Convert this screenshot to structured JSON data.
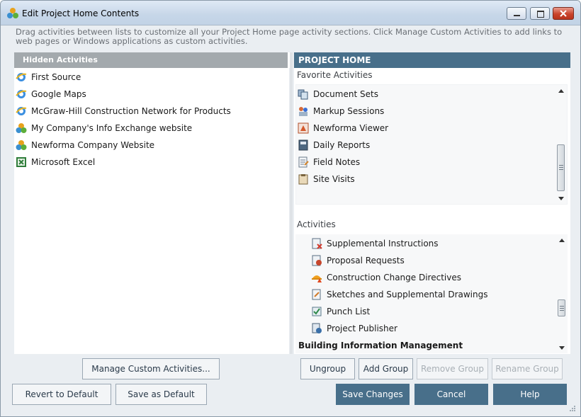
{
  "window": {
    "title": "Edit Project Home Contents"
  },
  "description": "Drag activities between lists to customize all your Project Home page activity sections.  Click Manage Custom Activities to add links to web pages or Windows applications as custom activities.",
  "hidden": {
    "header": "Hidden Activities",
    "items": [
      {
        "label": "First Source",
        "icon": "ie-icon"
      },
      {
        "label": "Google Maps",
        "icon": "ie-icon"
      },
      {
        "label": "McGraw-Hill Construction Network for Products",
        "icon": "ie-icon"
      },
      {
        "label": "My Company's Info Exchange website",
        "icon": "newforma-icon"
      },
      {
        "label": "Newforma Company Website",
        "icon": "newforma-icon"
      },
      {
        "label": "Microsoft Excel",
        "icon": "excel-icon"
      }
    ]
  },
  "project_home": {
    "header": "PROJECT HOME",
    "favorites_label": "Favorite Activities",
    "favorites": [
      {
        "label": "Document Sets",
        "icon": "document-sets-icon"
      },
      {
        "label": "Markup Sessions",
        "icon": "markup-sessions-icon"
      },
      {
        "label": "Newforma Viewer",
        "icon": "viewer-icon"
      },
      {
        "label": "Daily Reports",
        "icon": "daily-reports-icon"
      },
      {
        "label": "Field Notes",
        "icon": "field-notes-icon"
      },
      {
        "label": "Site Visits",
        "icon": "site-visits-icon"
      }
    ],
    "activities_label": "Activities",
    "activities": [
      {
        "label": "Supplemental Instructions",
        "icon": "supplemental-instructions-icon"
      },
      {
        "label": "Proposal Requests",
        "icon": "proposal-requests-icon"
      },
      {
        "label": "Construction Change Directives",
        "icon": "construction-icon"
      },
      {
        "label": "Sketches and Supplemental Drawings",
        "icon": "sketches-icon"
      },
      {
        "label": "Punch List",
        "icon": "punch-list-icon"
      },
      {
        "label": "Project Publisher",
        "icon": "project-publisher-icon"
      }
    ],
    "group_title": "Building Information Management"
  },
  "buttons": {
    "manage": "Manage Custom Activities...",
    "ungroup": "Ungroup",
    "add_group": "Add Group",
    "remove_group": "Remove Group",
    "rename_group": "Rename Group",
    "revert": "Revert to Default",
    "save_default": "Save as Default",
    "save_changes": "Save Changes",
    "cancel": "Cancel",
    "help": "Help"
  },
  "colors": {
    "accent": "#486f8a",
    "hidden_header": "#a3a9ad"
  }
}
